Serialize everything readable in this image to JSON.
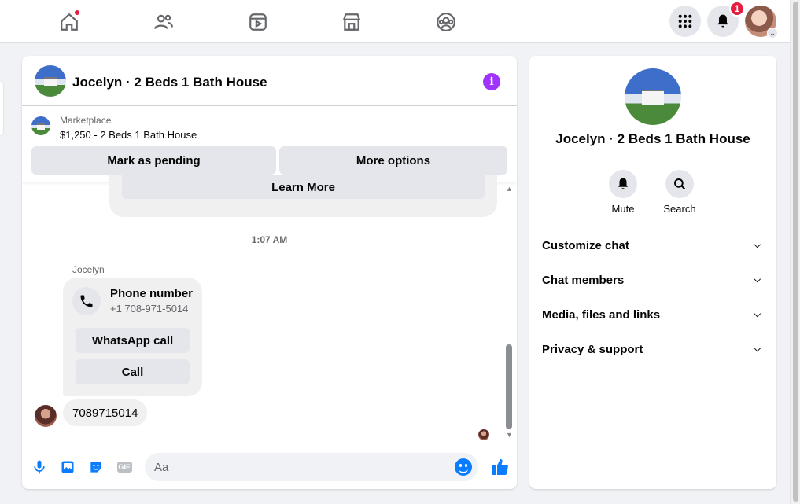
{
  "topnav": {
    "notifications_count": "1",
    "icons": [
      "home-icon",
      "friends-icon",
      "watch-icon",
      "marketplace-icon",
      "groups-icon",
      "menu-grid-icon",
      "bell-icon"
    ]
  },
  "chat": {
    "title": "Jocelyn · 2 Beds 1 Bath House",
    "marketplace": {
      "label": "Marketplace",
      "listing": "$1,250 - 2 Beds 1 Bath House",
      "pending_label": "Mark as pending",
      "more_label": "More options"
    },
    "learn_more": "Learn More",
    "timestamp": "1:07 AM",
    "sender": "Jocelyn",
    "phone_card": {
      "title": "Phone number",
      "number": "+1 708-971-5014",
      "whatsapp_label": "WhatsApp call",
      "call_label": "Call"
    },
    "last_message": "7089715014",
    "composer_placeholder": "Aa",
    "gif_label": "GIF"
  },
  "info": {
    "name": "Jocelyn · 2 Beds 1 Bath House",
    "actions": [
      {
        "label": "Mute",
        "icon": "bell-icon"
      },
      {
        "label": "Search",
        "icon": "search-icon"
      }
    ],
    "sections": [
      {
        "label": "Customize chat"
      },
      {
        "label": "Chat members"
      },
      {
        "label": "Media, files and links"
      },
      {
        "label": "Privacy & support"
      }
    ]
  },
  "colors": {
    "accent": "#0a7cff",
    "info_purple": "#a033ff",
    "badge_red": "#e41e3f"
  }
}
